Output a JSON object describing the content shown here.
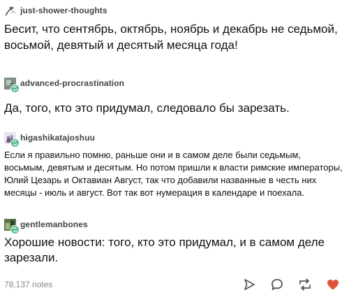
{
  "posts": [
    {
      "username": "just-shower-thoughts",
      "text": "Бесит, что сентябрь, октябрь, ноябрь и декабрь не седьмой, восьмой, девятый и десятый месяца года!"
    },
    {
      "username": "advanced-procrastination",
      "text": "Да, того, кто это придумал, следовало бы зарезать."
    },
    {
      "username": "higashikatajoshuu",
      "text": "Если я правильно помню, раньше они и в самом деле были седьмым, восьмым, девятым и десятым. Но потом пришли к власти римские императоры, Юлий Цезарь и Октавиан Август, так что добавили названные в честь них месяцы - июль и август. Вот так вот нумерация в календаре и поехала."
    },
    {
      "username": "gentlemanbones",
      "text": "Хорошие новости: того, кто это придумал, и в самом деле зарезали."
    }
  ],
  "footer": {
    "notes": "78,137 notes"
  },
  "icons": {
    "share": "share-icon",
    "reply": "reply-icon",
    "reblog": "reblog-icon",
    "like": "heart-icon"
  },
  "colors": {
    "reblog_badge": "#56bc8a",
    "like": "#e0553a",
    "divider": "#d9d9d9"
  }
}
